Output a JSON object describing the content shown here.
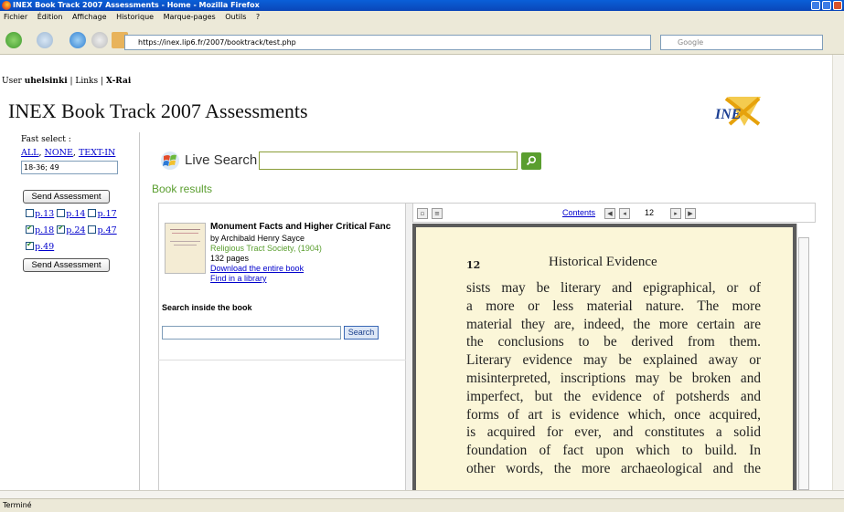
{
  "browser": {
    "title": "INEX Book Track 2007 Assessments - Home - Mozilla Firefox",
    "menu": [
      "Fichier",
      "Édition",
      "Affichage",
      "Historique",
      "Marque-pages",
      "Outils",
      "?"
    ],
    "url": "https://inex.lip6.fr/2007/booktrack/test.php",
    "search_placeholder": "Google",
    "status": "Terminé"
  },
  "header": {
    "user_prefix": "User",
    "user": "uhelsinki",
    "links": "Links",
    "xrai": "X-Rai",
    "title": "INEX Book Track 2007 Assessments"
  },
  "sidebar": {
    "fast_select_label": "Fast select :",
    "all": "ALL",
    "none": "NONE",
    "text_in": "TEXT-IN",
    "fast_input_value": "18-36; 49",
    "send_label": "Send Assessment",
    "pages": [
      {
        "label": "p.13",
        "checked": false
      },
      {
        "label": "p.14",
        "checked": false
      },
      {
        "label": "p.17",
        "checked": false
      },
      {
        "label": "p.18",
        "checked": true
      },
      {
        "label": "p.24",
        "checked": true
      },
      {
        "label": "p.47",
        "checked": false
      },
      {
        "label": "p.49",
        "checked": true
      }
    ]
  },
  "search": {
    "brand": "Live Search",
    "results_heading": "Book results"
  },
  "book": {
    "title": "Monument Facts and Higher Critical Fanc",
    "author": "by Archibald Henry Sayce",
    "publisher": "Religious Tract Society, (1904)",
    "pages": "132 pages",
    "download": "Download the entire book",
    "library": "Find in a library",
    "search_inside_label": "Search inside the book",
    "search_button": "Search"
  },
  "viewer": {
    "contents_link": "Contents",
    "page_number": "12",
    "page": {
      "number": "12",
      "heading": "Historical Evidence",
      "lines": [
        "sists may be literary and epigraphical, or of",
        "a more or less material nature.  The more",
        "material they are, indeed, the more certain are",
        "the conclusions to be derived from them.",
        "Literary evidence may be explained away or",
        "misinterpreted, inscriptions may be broken and",
        "imperfect, but the evidence of potsherds and",
        "forms of art is evidence which, once acquired,",
        "is acquired for ever, and constitutes a solid",
        "foundation of fact upon which to build.  In",
        "other words, the more archaeological and the"
      ]
    }
  }
}
